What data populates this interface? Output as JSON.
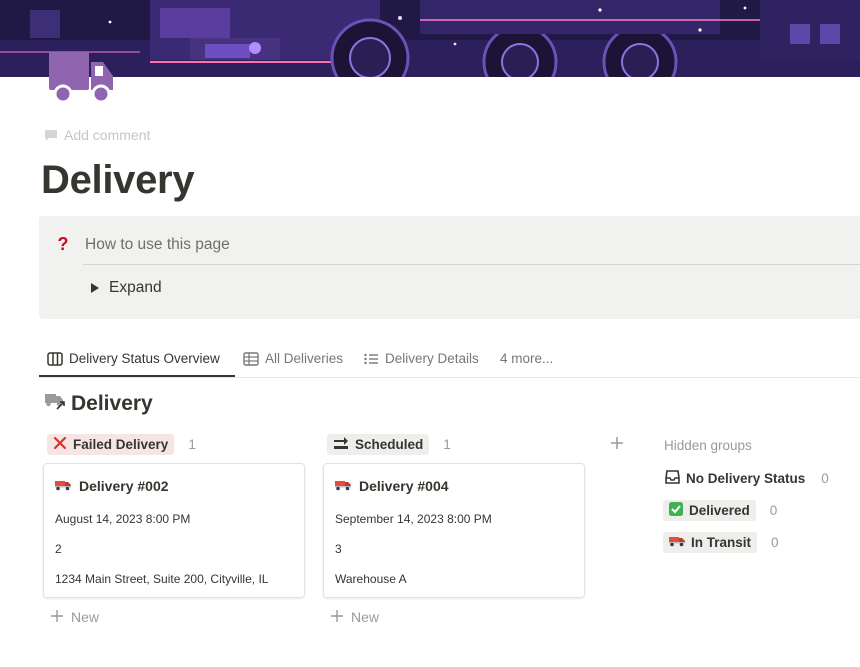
{
  "page": {
    "add_comment": "Add comment",
    "title": "Delivery",
    "icon": "truck-icon",
    "accent_color": "#9065b0"
  },
  "callout": {
    "icon": "question-icon",
    "heading": "How to use this page",
    "toggle_label": "Expand"
  },
  "tabs": [
    {
      "label": "Delivery Status Overview",
      "icon": "board-icon",
      "active": true
    },
    {
      "label": "All Deliveries",
      "icon": "table-icon",
      "active": false
    },
    {
      "label": "Delivery Details",
      "icon": "list-icon",
      "active": false
    },
    {
      "label": "4 more...",
      "icon": "",
      "active": false
    }
  ],
  "database": {
    "title": "Delivery",
    "icon": "linked-truck-icon"
  },
  "groups": [
    {
      "label": "Failed Delivery",
      "icon": "x-icon",
      "count": "1",
      "color": "#f5e6e4",
      "card": {
        "icon": "truck-emoji-icon",
        "title": "Delivery #002",
        "date": "August 14, 2023 8:00 PM",
        "quantity": "2",
        "location": "1234 Main Street, Suite 200, Cityville, IL"
      },
      "new_label": "New"
    },
    {
      "label": "Scheduled",
      "icon": "soon-arrow-icon",
      "count": "1",
      "color": "#eeeeec",
      "card": {
        "icon": "truck-emoji-icon",
        "title": "Delivery #004",
        "date": "September 14, 2023 8:00 PM",
        "quantity": "3",
        "location": "Warehouse A"
      },
      "new_label": "New"
    }
  ],
  "hidden_groups": {
    "title": "Hidden groups",
    "items": [
      {
        "label": "No Delivery Status",
        "icon": "inbox-icon",
        "count": "0"
      },
      {
        "label": "Delivered",
        "icon": "check-box-icon",
        "count": "0"
      },
      {
        "label": "In Transit",
        "icon": "truck-emoji-icon",
        "count": "0"
      }
    ]
  }
}
